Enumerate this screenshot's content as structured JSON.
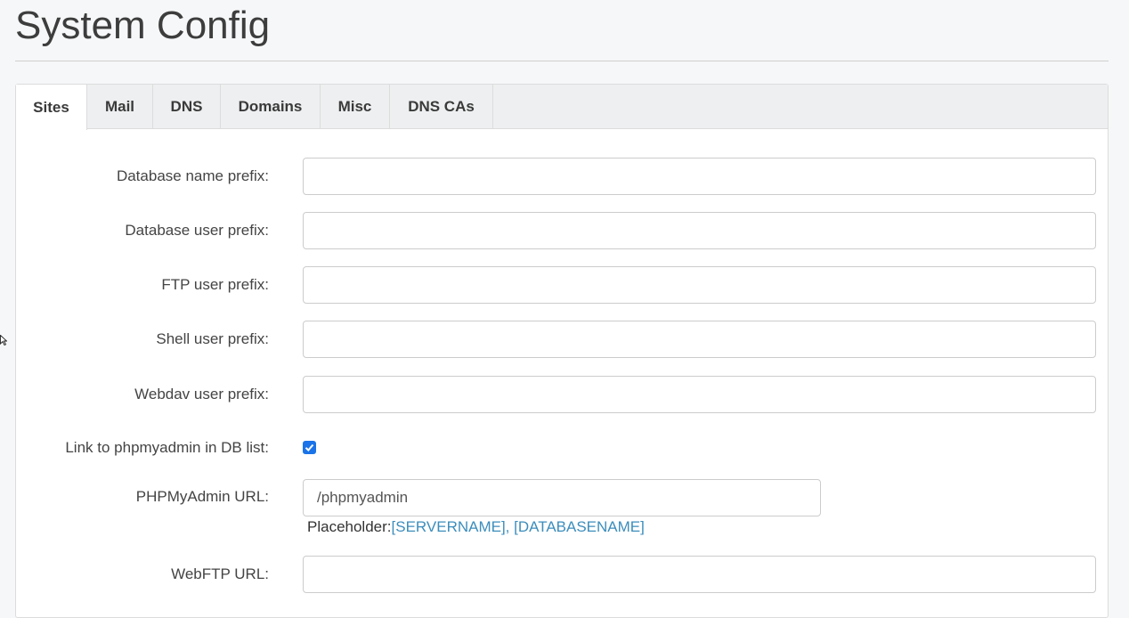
{
  "page": {
    "title": "System Config"
  },
  "tabs": [
    {
      "label": "Sites",
      "active": true
    },
    {
      "label": "Mail"
    },
    {
      "label": "DNS"
    },
    {
      "label": "Domains"
    },
    {
      "label": "Misc"
    },
    {
      "label": "DNS CAs"
    }
  ],
  "form": {
    "db_name_prefix": {
      "label": "Database name prefix:",
      "value": ""
    },
    "db_user_prefix": {
      "label": "Database user prefix:",
      "value": ""
    },
    "ftp_user_prefix": {
      "label": "FTP user prefix:",
      "value": ""
    },
    "shell_user_prefix": {
      "label": "Shell user prefix:",
      "value": ""
    },
    "webdav_user_prefix": {
      "label": "Webdav user prefix:",
      "value": ""
    },
    "phpmyadmin_link": {
      "label": "Link to phpmyadmin in DB list:",
      "checked": true
    },
    "phpmyadmin_url": {
      "label": "PHPMyAdmin URL:",
      "value": "/phpmyadmin",
      "hint_prefix": "Placeholder:",
      "hint_placeholders": "[SERVERNAME], [DATABASENAME]"
    },
    "webftp_url": {
      "label": "WebFTP URL:",
      "value": ""
    }
  },
  "colors": {
    "checkbox": "#1a73e8",
    "link": "#3c8dbc"
  },
  "icons": {
    "cursor": "mouse-cursor-icon",
    "check": "check-icon"
  }
}
